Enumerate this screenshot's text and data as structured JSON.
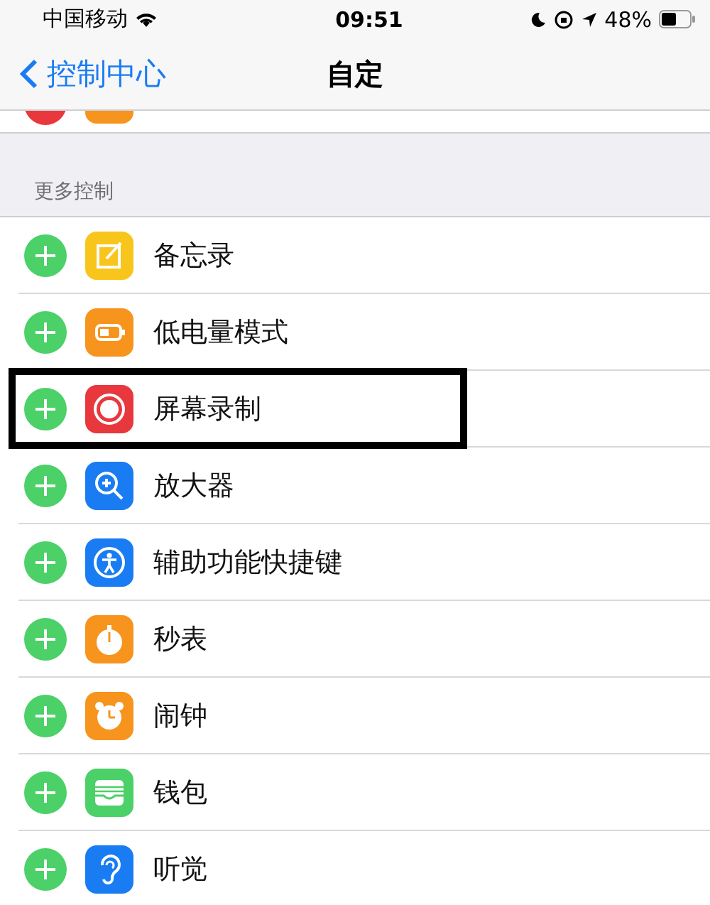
{
  "status_bar": {
    "carrier": "中国移动",
    "time": "09:51",
    "battery": "48%"
  },
  "nav": {
    "back": "控制中心",
    "title": "自定"
  },
  "section": {
    "header": "更多控制"
  },
  "controls": [
    {
      "label": "备忘录",
      "kind": "notes",
      "highlighted": false
    },
    {
      "label": "低电量模式",
      "kind": "battery",
      "highlighted": false
    },
    {
      "label": "屏幕录制",
      "kind": "record",
      "highlighted": true
    },
    {
      "label": "放大器",
      "kind": "magnifier",
      "highlighted": false
    },
    {
      "label": "辅助功能快捷键",
      "kind": "accessibility",
      "highlighted": false
    },
    {
      "label": "秒表",
      "kind": "stopwatch",
      "highlighted": false
    },
    {
      "label": "闹钟",
      "kind": "alarm",
      "highlighted": false
    },
    {
      "label": "钱包",
      "kind": "wallet",
      "highlighted": false
    },
    {
      "label": "听觉",
      "kind": "hearing",
      "highlighted": false
    }
  ]
}
